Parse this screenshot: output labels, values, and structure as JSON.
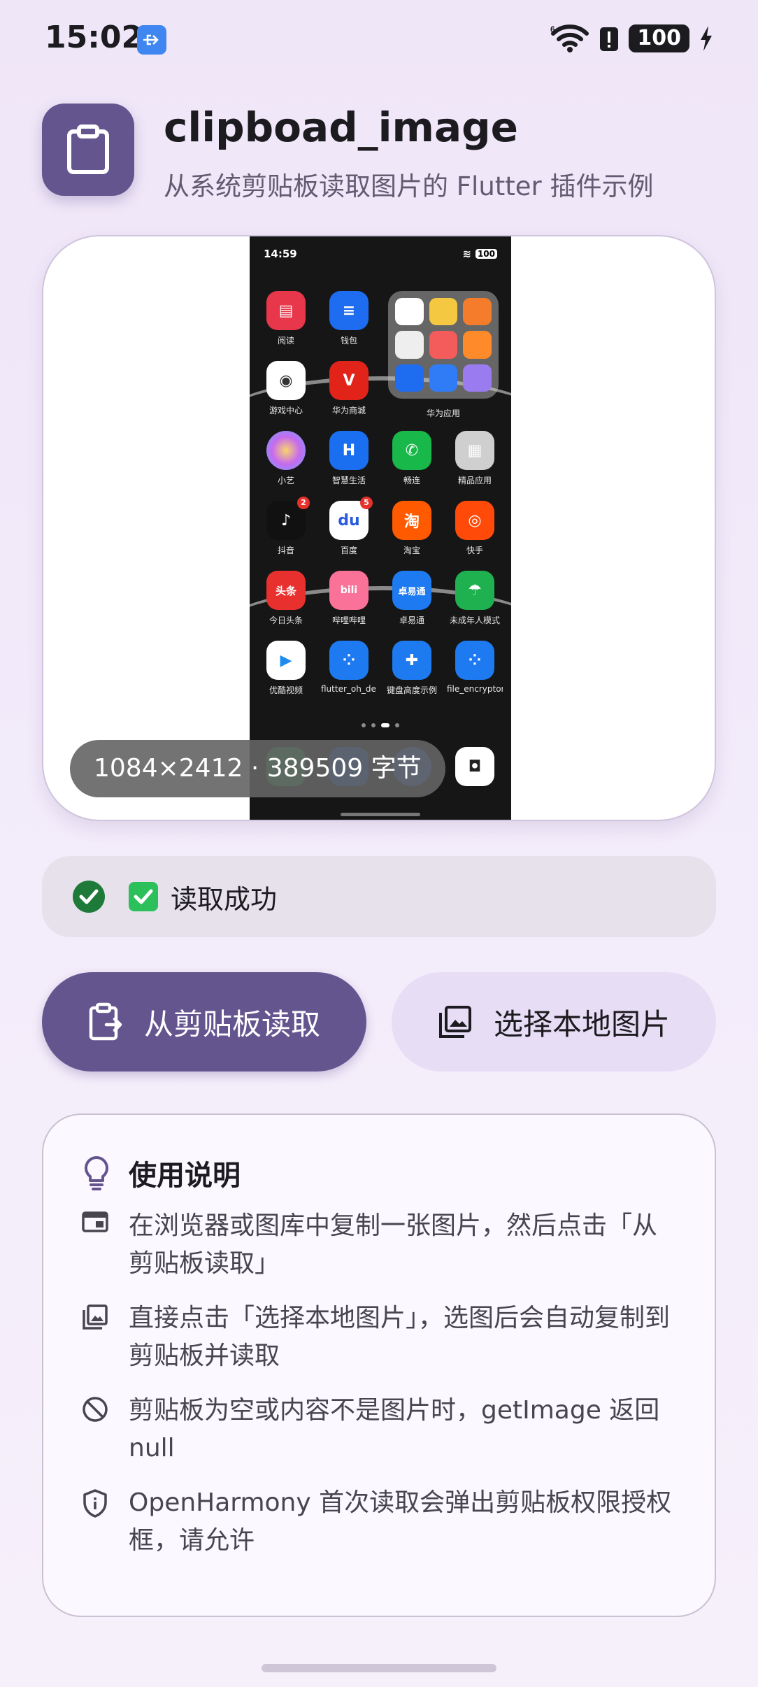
{
  "status_bar": {
    "time": "15:02",
    "battery": "100",
    "icons": [
      "usb-icon",
      "wifi-icon",
      "alert-icon",
      "battery-icon",
      "charging-icon"
    ]
  },
  "header": {
    "title": "clipboad_image",
    "subtitle": "从系统剪贴板读取图片的 Flutter 插件示例",
    "icon": "clipboard-icon"
  },
  "preview": {
    "info": "1084×2412 · 389509 字节",
    "screenshot": {
      "time": "14:59",
      "battery": "100",
      "folder_label": "华为应用",
      "apps": [
        {
          "label": "阅读"
        },
        {
          "label": "钱包"
        },
        {
          "label": "游戏中心"
        },
        {
          "label": "华为商城"
        },
        {
          "label": "小艺"
        },
        {
          "label": "智慧生活"
        },
        {
          "label": "畅连"
        },
        {
          "label": "精品应用"
        },
        {
          "label": "抖音",
          "badge": "2"
        },
        {
          "label": "百度",
          "badge": "5"
        },
        {
          "label": "淘宝"
        },
        {
          "label": "快手"
        },
        {
          "label": "今日头条"
        },
        {
          "label": "哔哩哔哩"
        },
        {
          "label": "卓易通"
        },
        {
          "label": "未成年人模式"
        },
        {
          "label": "优酷视频"
        },
        {
          "label": "flutter_oh_de..."
        },
        {
          "label": "键盘高度示例"
        },
        {
          "label": "file_encryptor..."
        }
      ]
    }
  },
  "status": {
    "text": "读取成功",
    "state": "success"
  },
  "buttons": {
    "read_clipboard": "从剪贴板读取",
    "pick_local": "选择本地图片"
  },
  "instructions": {
    "title": "使用说明",
    "tips": [
      {
        "icon": "browser-icon",
        "text": "在浏览器或图库中复制一张图片，然后点击「从剪贴板读取」"
      },
      {
        "icon": "gallery-icon",
        "text": "直接点击「选择本地图片」，选图后会自动复制到剪贴板并读取"
      },
      {
        "icon": "block-icon",
        "text": "剪贴板为空或内容不是图片时，getImage 返回 null"
      },
      {
        "icon": "shield-icon",
        "text": "OpenHarmony 首次读取会弹出剪贴板权限授权框，请允许"
      }
    ]
  },
  "colors": {
    "primary": "#64558f",
    "secondary_button": "#e7def6",
    "success": "#1e7a38",
    "background": "#efe6f8"
  }
}
